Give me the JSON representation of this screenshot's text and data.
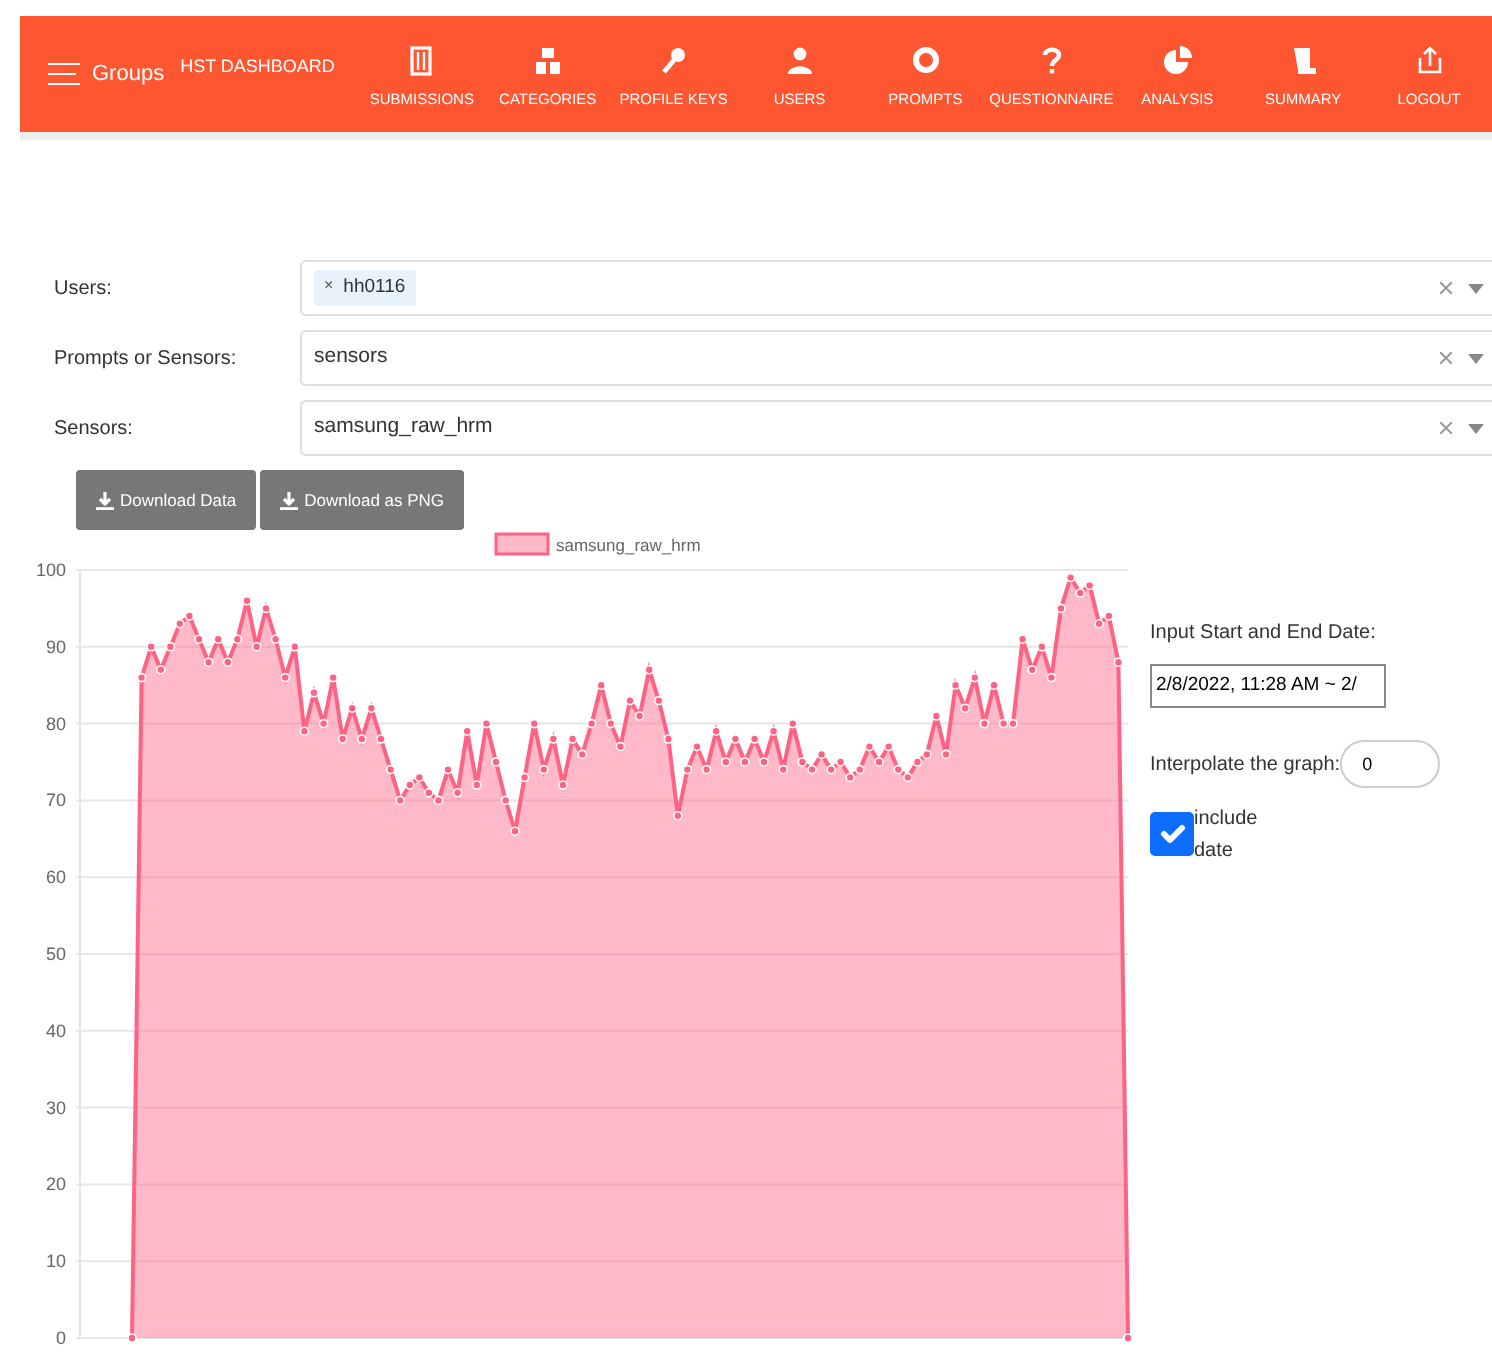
{
  "navbar": {
    "menu_label": "Groups",
    "brand": "HST DASHBOARD",
    "items": [
      {
        "label": "SUBMISSIONS"
      },
      {
        "label": "CATEGORIES"
      },
      {
        "label": "PROFILE KEYS"
      },
      {
        "label": "USERS"
      },
      {
        "label": "PROMPTS"
      },
      {
        "label": "QUESTIONNAIRE"
      },
      {
        "label": "ANALYSIS"
      },
      {
        "label": "SUMMARY"
      },
      {
        "label": "LOGOUT"
      }
    ]
  },
  "filters": [
    {
      "label": "Users:",
      "kind": "tags",
      "tags": [
        {
          "remove": "×",
          "label": "hh0116"
        }
      ]
    },
    {
      "label": "Prompts or Sensors:",
      "kind": "single",
      "value": "sensors"
    },
    {
      "label": "Sensors:",
      "kind": "single",
      "value": "samsung_raw_hrm"
    }
  ],
  "buttons": [
    "Download Data",
    "Download as PNG"
  ],
  "chart": {
    "chart_data": {
      "type": "area",
      "grid": true,
      "ylim": [
        0,
        100
      ],
      "yticks": [
        0,
        10,
        20,
        30,
        40,
        50,
        60,
        70,
        80,
        90,
        100
      ],
      "series": [
        {
          "name": "samsung_raw_hrm",
          "color": "#ff6384",
          "values": [
            0,
            86,
            90,
            87,
            90,
            93,
            94,
            91,
            88,
            91,
            88,
            91,
            96,
            90,
            95,
            91,
            86,
            90,
            79,
            84,
            80,
            86,
            78,
            82,
            78,
            82,
            78,
            74,
            70,
            72,
            73,
            71,
            70,
            74,
            71,
            79,
            72,
            80,
            75,
            70,
            66,
            73,
            80,
            74,
            78,
            72,
            78,
            76,
            80,
            85,
            80,
            77,
            83,
            81,
            87,
            83,
            78,
            68,
            74,
            77,
            74,
            79,
            75,
            78,
            75,
            78,
            75,
            79,
            74,
            80,
            75,
            74,
            76,
            74,
            75,
            73,
            74,
            77,
            75,
            77,
            74,
            73,
            75,
            76,
            81,
            76,
            85,
            82,
            86,
            80,
            85,
            80,
            80,
            91,
            87,
            90,
            86,
            95,
            99,
            97,
            98,
            93,
            94,
            88,
            0
          ]
        }
      ]
    }
  },
  "side": {
    "date_label": "Input Start and End Date:",
    "date_value": "2/8/2022, 11:28 AM ~ 2/",
    "interpolate_label": "Interpolate the graph:",
    "interpolate_value": "0",
    "include_date": {
      "label": "include date",
      "checked": true
    }
  }
}
